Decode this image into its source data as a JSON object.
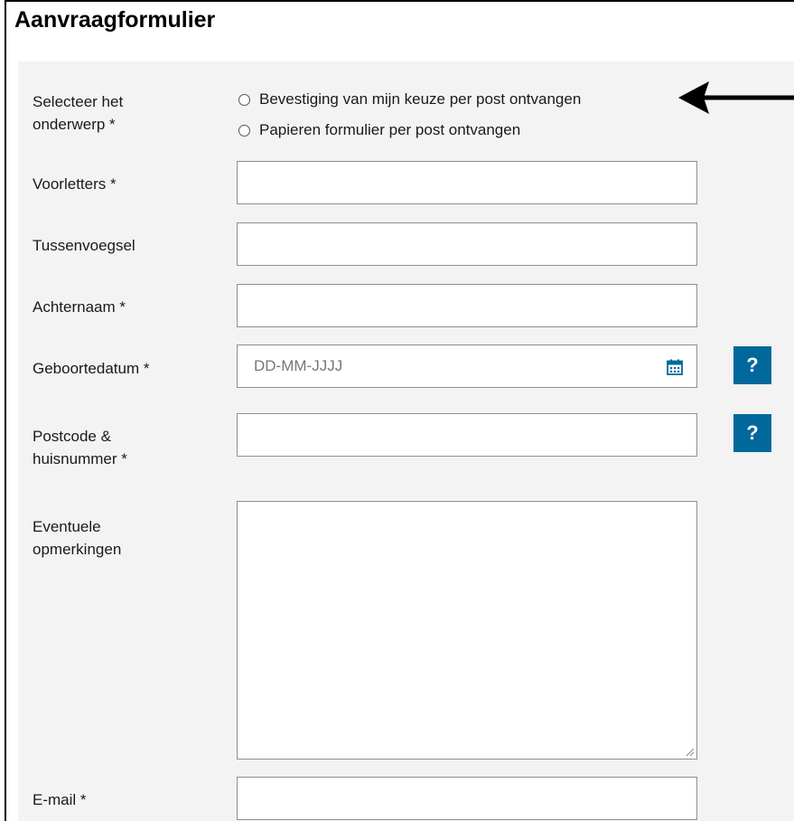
{
  "form": {
    "title": "Aanvraagformulier",
    "subject": {
      "label_line1": "Selecteer het",
      "label_line2": "onderwerp *",
      "options": [
        "Bevestiging van mijn keuze per post ontvangen",
        "Papieren formulier per post ontvangen"
      ]
    },
    "initials": {
      "label": "Voorletters *",
      "value": ""
    },
    "prefix": {
      "label": "Tussenvoegsel",
      "value": ""
    },
    "lastname": {
      "label": "Achternaam *",
      "value": ""
    },
    "birthdate": {
      "label": "Geboortedatum *",
      "placeholder": "DD-MM-JJJJ",
      "value": ""
    },
    "postcode": {
      "label_line1": "Postcode &",
      "label_line2": "huisnummer *",
      "value": ""
    },
    "remarks": {
      "label_line1": "Eventuele",
      "label_line2": "opmerkingen",
      "value": ""
    },
    "email": {
      "label": "E-mail *",
      "value": ""
    },
    "help_label": "?"
  },
  "colors": {
    "panel_bg": "#f3f3f3",
    "help_button": "#01689b",
    "calendar_icon": "#01689b"
  },
  "icons": {
    "calendar": "calendar-icon",
    "help": "help-icon",
    "annotation_arrow": "arrow-left-icon"
  }
}
